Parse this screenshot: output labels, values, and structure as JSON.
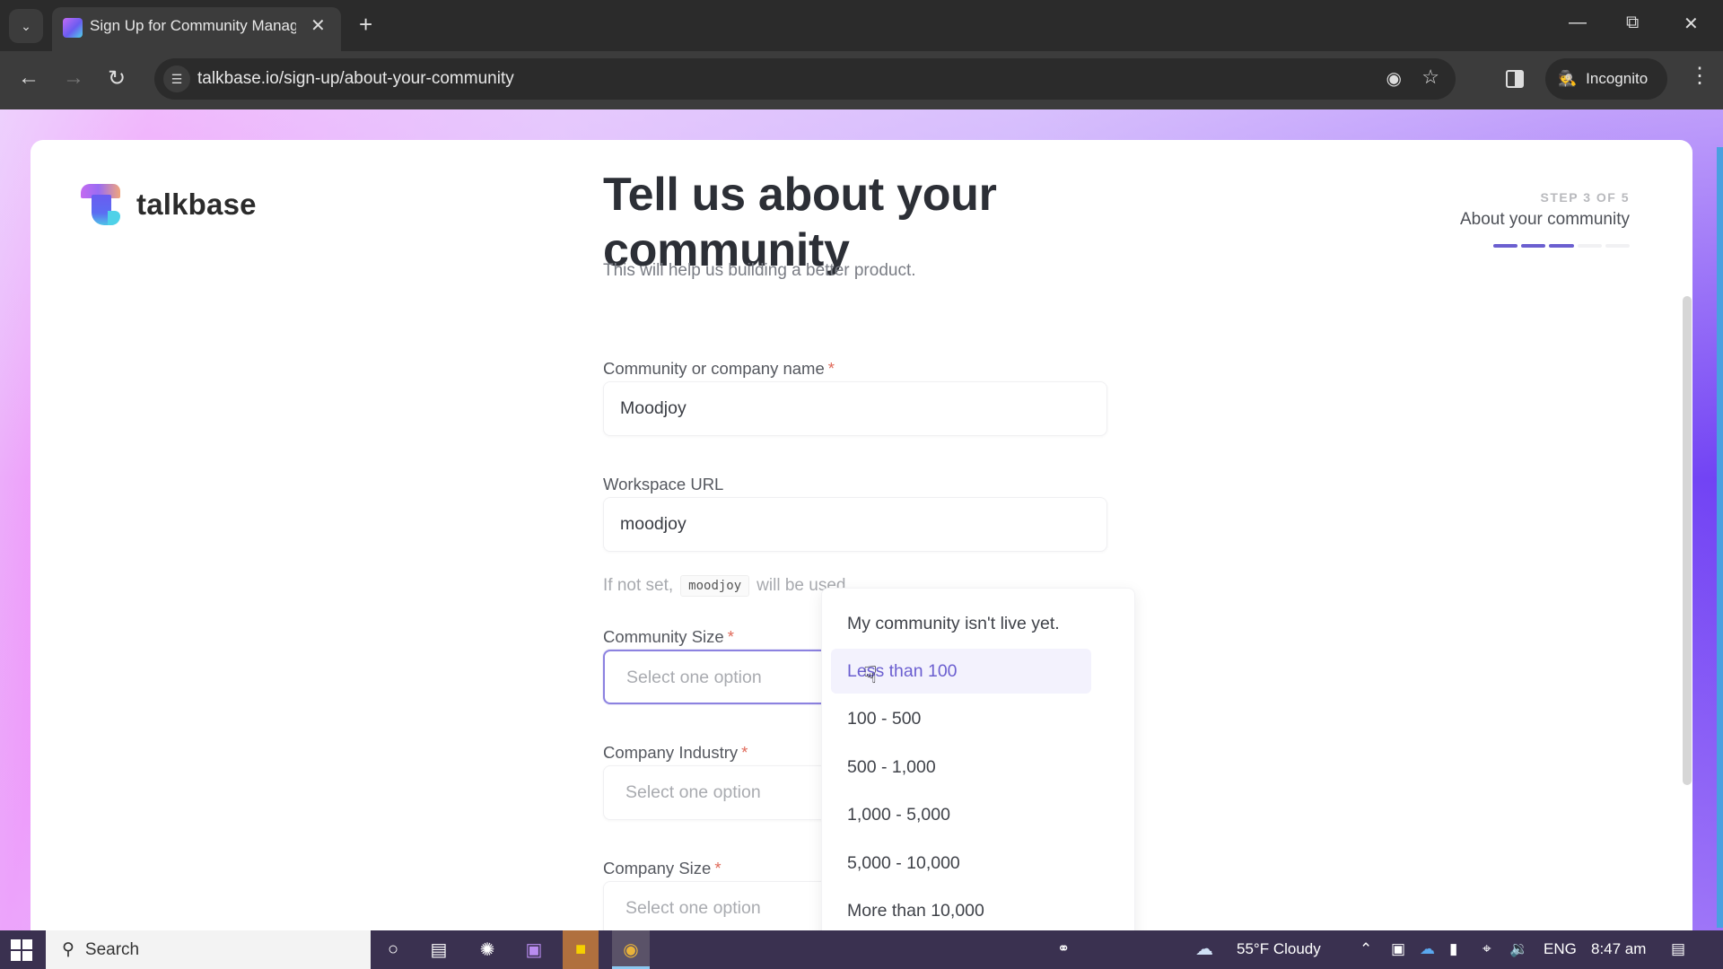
{
  "browser": {
    "tab_title": "Sign Up for Community Manag",
    "url": "talkbase.io/sign-up/about-your-community",
    "profile_label": "Incognito"
  },
  "brand": {
    "name": "talkbase",
    "accent_color": "#6b5fd0"
  },
  "header": {
    "title": "Tell us about your community",
    "subtitle": "This will help us building a better product."
  },
  "progress": {
    "step_label": "STEP 3 OF 5",
    "step_title": "About your community",
    "current_step": 3,
    "total_steps": 5,
    "active_color": "#6b5fd0",
    "inactive_color": "#f1f1f3"
  },
  "form": {
    "community_name": {
      "label": "Community or company name",
      "required_mark": "*",
      "value": "Moodjoy"
    },
    "workspace_url": {
      "label": "Workspace URL",
      "value": "moodjoy",
      "hint_prefix": "If not set,",
      "hint_code": "moodjoy",
      "hint_suffix": "will be used."
    },
    "community_size": {
      "label": "Community Size",
      "required_mark": "*",
      "placeholder": "Select one option",
      "options": [
        "My community isn't live yet.",
        "Less than 100",
        "100 - 500",
        "500 - 1,000",
        "1,000 - 5,000",
        "5,000 - 10,000",
        "More than 10,000"
      ],
      "hovered_option": "Less than 100"
    },
    "company_industry": {
      "label": "Company Industry",
      "required_mark": "*",
      "placeholder": "Select one option"
    },
    "company_size": {
      "label": "Company Size",
      "required_mark": "*",
      "placeholder": "Select one option"
    }
  },
  "taskbar": {
    "search_label": "Search",
    "weather": "55°F  Cloudy",
    "language": "ENG",
    "time": "8:47 am"
  }
}
